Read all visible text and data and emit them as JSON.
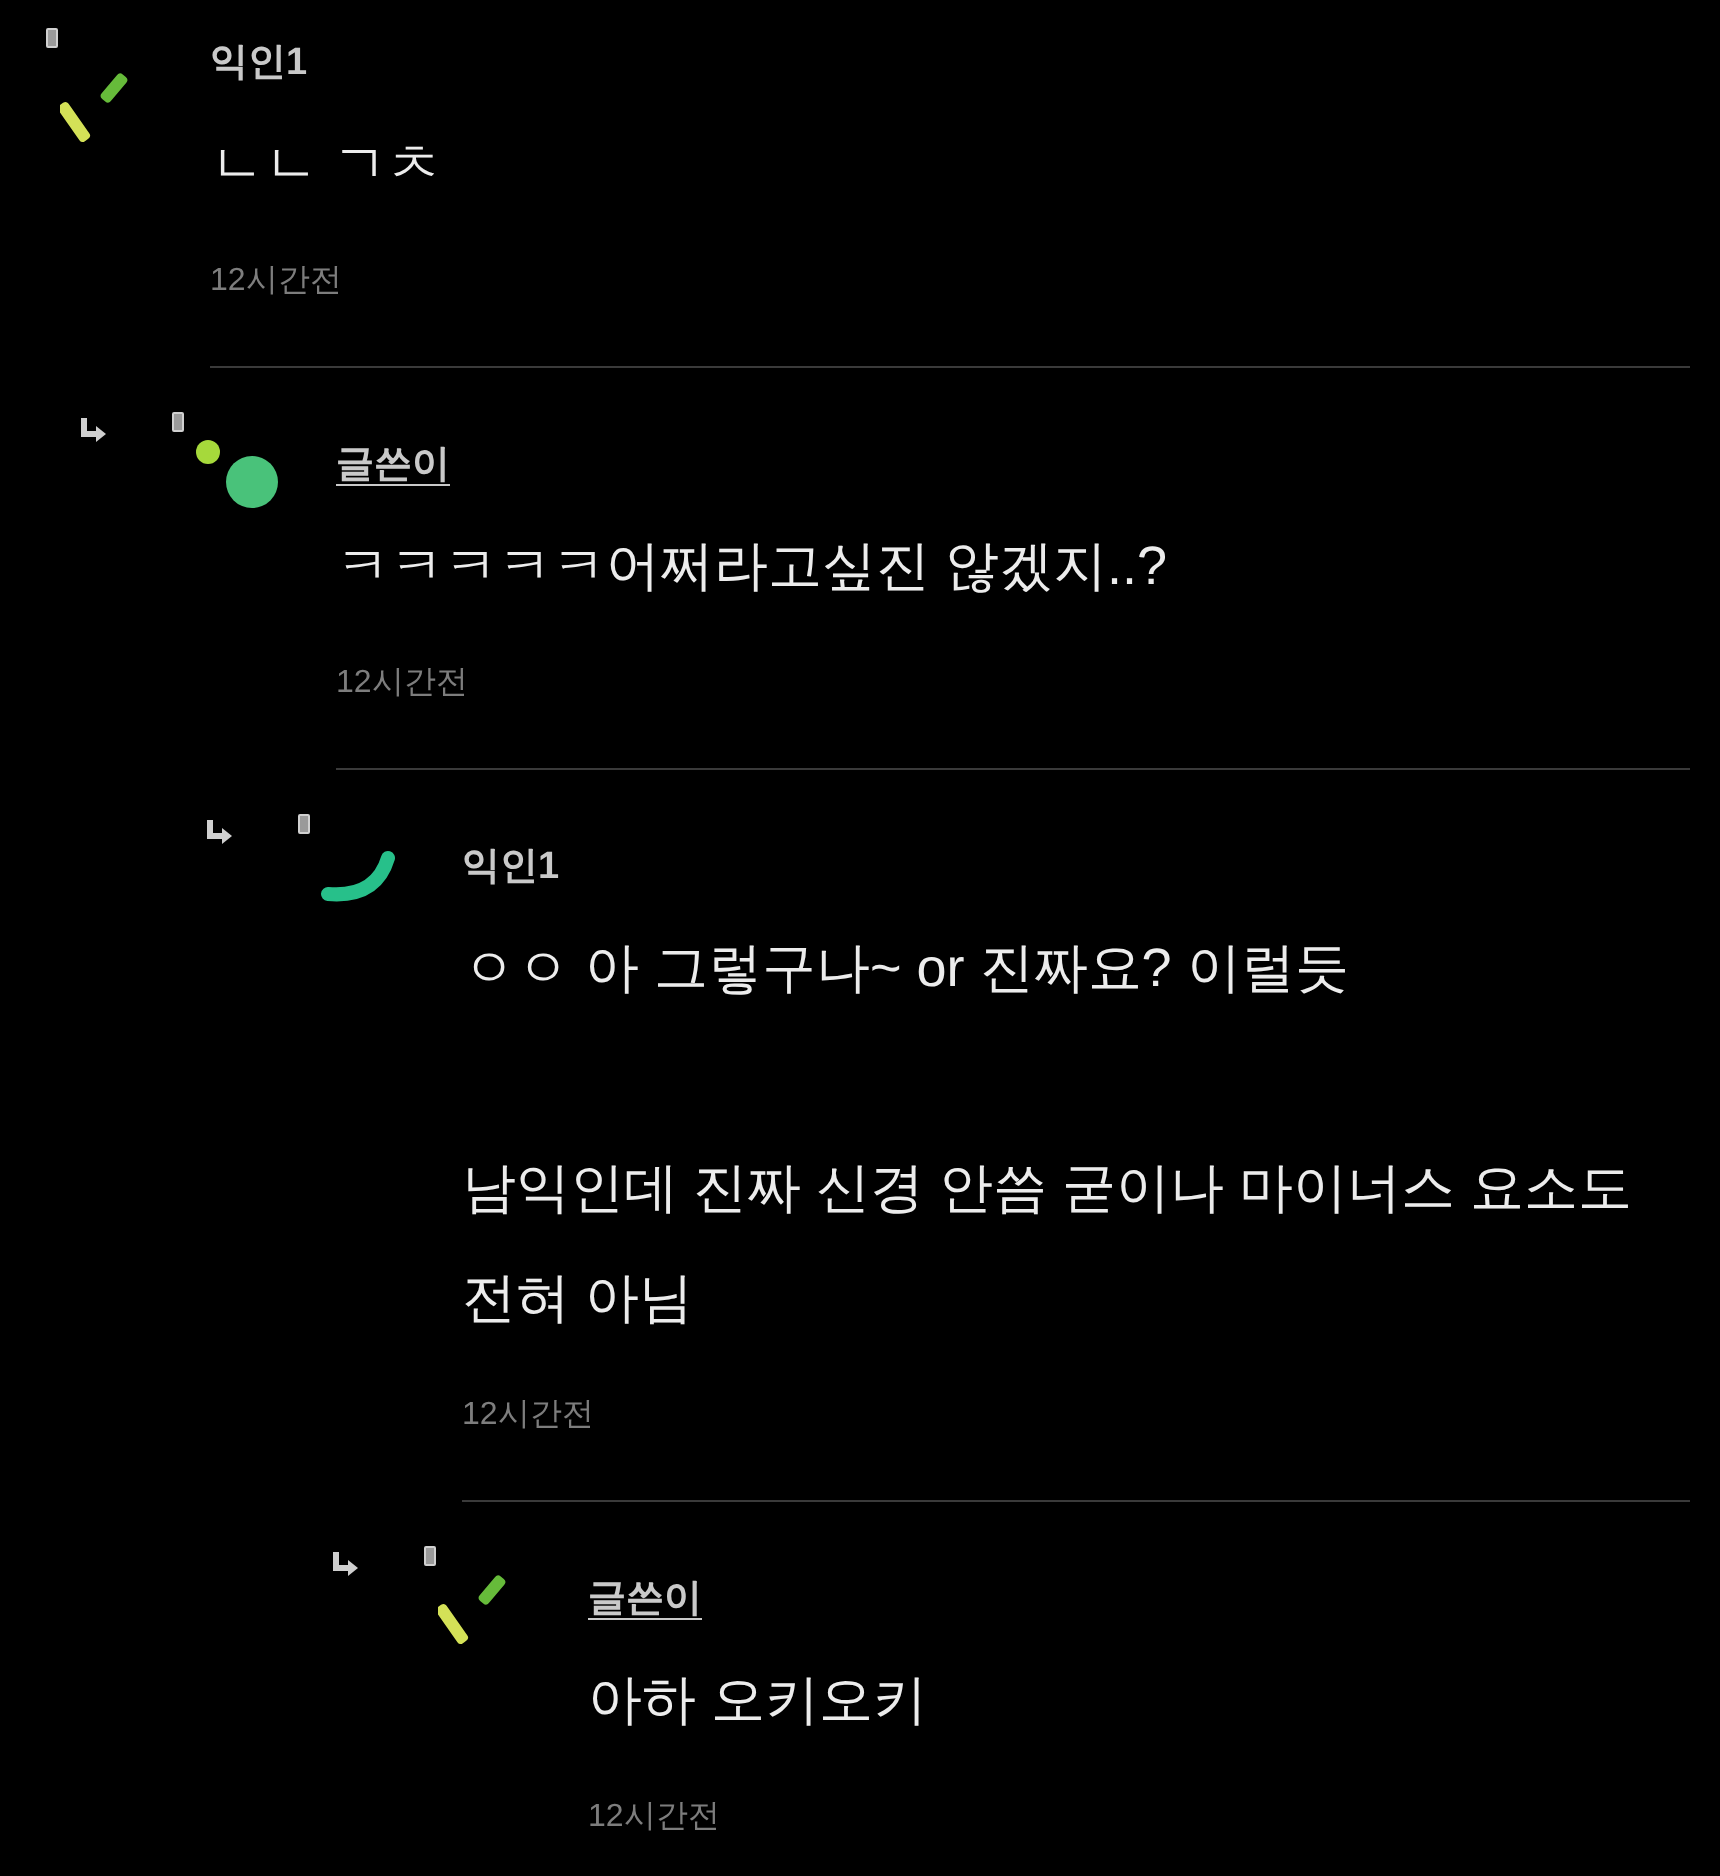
{
  "comments": [
    {
      "author": "익인1",
      "kind": "member",
      "avatar": {
        "kind": "sticks"
      },
      "body": [
        "ㄴㄴ ㄱㅊ"
      ],
      "time": "12시간전",
      "children": [
        {
          "author": "글쓴이",
          "kind": "op",
          "avatar": {
            "kind": "dots"
          },
          "body": [
            "ㅋㅋㅋㅋㅋ어쩌라고싶진 않겠지..?"
          ],
          "time": "12시간전",
          "children": [
            {
              "author": "익인1",
              "kind": "member",
              "avatar": {
                "kind": "arc"
              },
              "body": [
                "ㅇㅇ 아 그렇구나~ or 진짜요? 이럴듯",
                "남익인데 진짜 신경 안씀 굳이나 마이너스 요소도 전혀 아님"
              ],
              "time": "12시간전",
              "children": [
                {
                  "author": "글쓴이",
                  "kind": "op",
                  "avatar": {
                    "kind": "sticks"
                  },
                  "body": [
                    "아하 오키오키"
                  ],
                  "time": "12시간전"
                }
              ]
            }
          ]
        }
      ]
    }
  ]
}
